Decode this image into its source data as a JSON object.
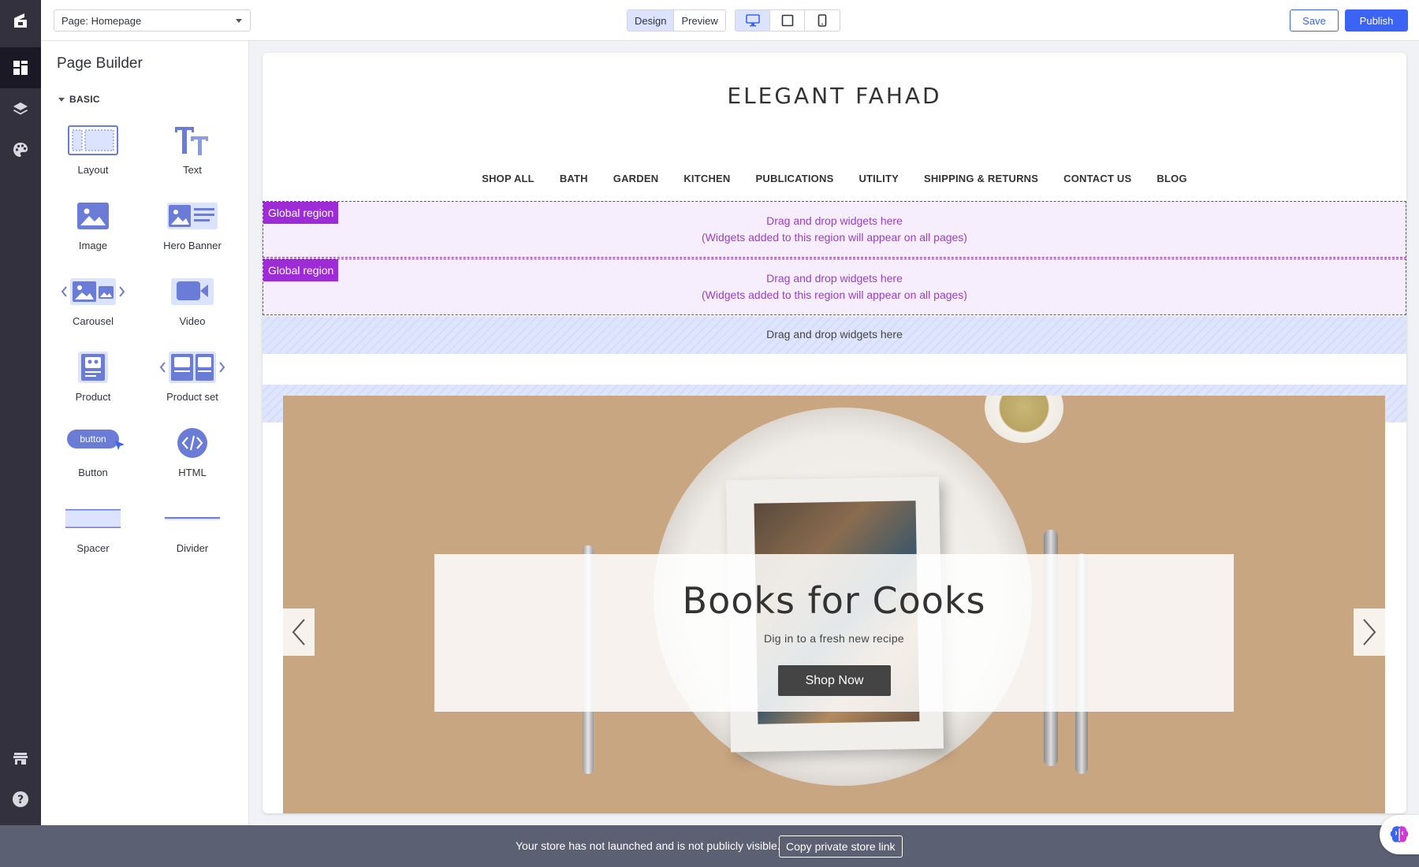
{
  "topbar": {
    "page_select": "Page: Homepage",
    "design_label": "Design",
    "preview_label": "Preview",
    "save_label": "Save",
    "publish_label": "Publish"
  },
  "panel": {
    "title": "Page Builder",
    "section": "BASIC",
    "widgets": {
      "layout": "Layout",
      "text": "Text",
      "image": "Image",
      "hero_banner": "Hero Banner",
      "carousel": "Carousel",
      "video": "Video",
      "product": "Product",
      "product_set": "Product set",
      "button": "Button",
      "button_icon_text": "button",
      "html": "HTML",
      "spacer": "Spacer",
      "divider": "Divider"
    }
  },
  "store": {
    "name": "ELEGANT FAHAD",
    "nav": [
      "SHOP ALL",
      "BATH",
      "GARDEN",
      "KITCHEN",
      "PUBLICATIONS",
      "UTILITY",
      "SHIPPING & RETURNS",
      "CONTACT US",
      "BLOG"
    ]
  },
  "regions": {
    "global_tag": "Global region",
    "global_line1": "Drag and drop widgets here",
    "global_line2": "(Widgets added to this region will appear on all pages)",
    "dropzone": "Drag and drop widgets here"
  },
  "hero": {
    "title": "Books for Cooks",
    "subtitle": "Dig in to a fresh new recipe",
    "button": "Shop Now"
  },
  "bottombar": {
    "message": "Your store has not launched and is not publicly visible.",
    "copy_link": "Copy private store link"
  },
  "colors": {
    "accent": "#3c64f4",
    "global_region": "#9d2bd6",
    "rail": "#34313f",
    "bottombar": "#5b6073"
  }
}
